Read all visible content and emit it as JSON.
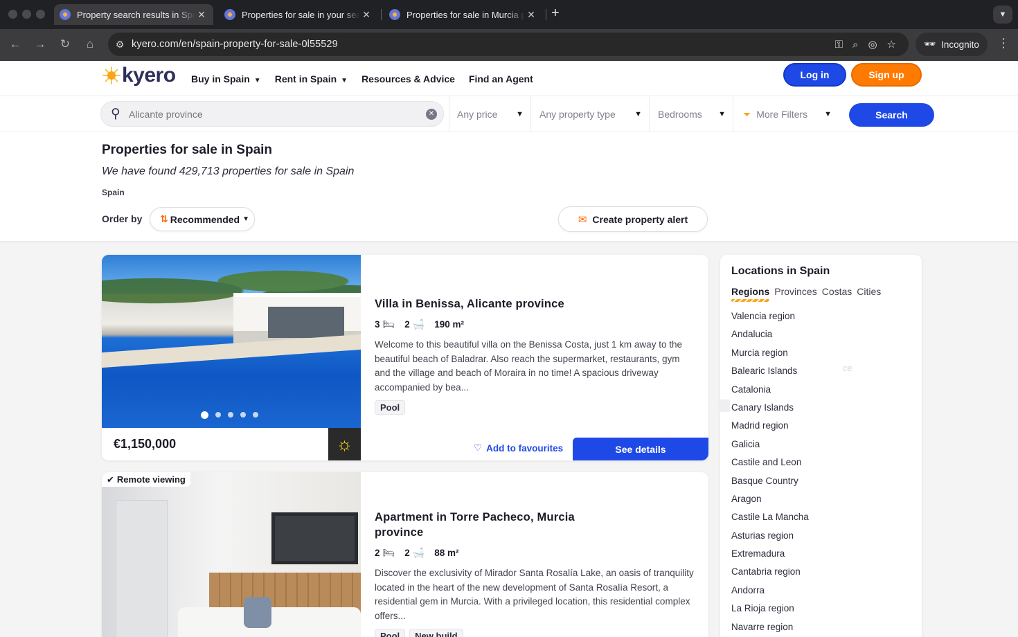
{
  "browser": {
    "tabs": [
      {
        "title": "Property search results in Spain",
        "active": true
      },
      {
        "title": "Properties for sale in your search",
        "active": false
      },
      {
        "title": "Properties for sale in Murcia province",
        "active": false
      }
    ],
    "url": "kyero.com/en/spain-property-for-sale-0l55529",
    "profile_label": "Incognito"
  },
  "header": {
    "logo_text": "kyero",
    "nav": [
      {
        "label": "Buy in Spain",
        "has_menu": true
      },
      {
        "label": "Rent in Spain",
        "has_menu": true
      },
      {
        "label": "Resources & Advice",
        "has_menu": false
      },
      {
        "label": "Find an Agent",
        "has_menu": false
      }
    ],
    "login_label": "Log in",
    "signup_label": "Sign up"
  },
  "search": {
    "location_placeholder": "Alicante province",
    "price_label": "Any price",
    "type_label": "Any property type",
    "bedrooms_label": "Bedrooms",
    "more_filters_label": "More Filters",
    "search_label": "Search"
  },
  "results": {
    "title": "Properties for sale in Spain",
    "found_text": "We have found 429,713 properties for sale in Spain",
    "breadcrumb": "Spain",
    "order_label": "Order by",
    "order_value": "Recommended",
    "alert_label": "Create property alert"
  },
  "listings": [
    {
      "title": "Villa in Benissa, Alicante province",
      "beds": "3",
      "baths": "2",
      "area": "190 m²",
      "description": "Welcome to this beautiful villa on the Benissa Costa, just 1 km away to the beautiful beach of Baladrar. Also reach the supermarket, restaurants, gym and the village and beach of Moraira in no time! A spacious driveway accompanied by bea...",
      "tags": [
        "Pool"
      ],
      "price": "€1,150,000",
      "fav_label": "Add to favourites",
      "details_label": "See details"
    },
    {
      "badge": "Remote viewing",
      "title": "Apartment in Torre Pacheco, Murcia province",
      "beds": "2",
      "baths": "2",
      "area": "88 m²",
      "description": "Discover the exclusivity of Mirador Santa Rosalía Lake, an oasis of tranquility located in the heart of the new development of Santa Rosalía Resort, a residential gem in Murcia. With a privileged location, this residential complex offers...",
      "tags": [
        "Pool",
        "New build"
      ]
    }
  ],
  "sidebar": {
    "title": "Locations in Spain",
    "tabs": [
      "Regions",
      "Provinces",
      "Costas",
      "Cities"
    ],
    "active_tab": "Regions",
    "regions": [
      "Valencia region",
      "Andalucia",
      "Murcia region",
      "Balearic Islands",
      "Catalonia",
      "Canary Islands",
      "Madrid region",
      "Galicia",
      "Castile and Leon",
      "Basque Country",
      "Aragon",
      "Castile La Mancha",
      "Asturias region",
      "Extremadura",
      "Cantabria region",
      "Andorra",
      "La Rioja region",
      "Navarre region"
    ],
    "ghost_text": "ce"
  },
  "colors": {
    "brand_blue": "#1f49e6",
    "brand_orange": "#ff7a00",
    "logo_navy": "#2f2f5b"
  }
}
